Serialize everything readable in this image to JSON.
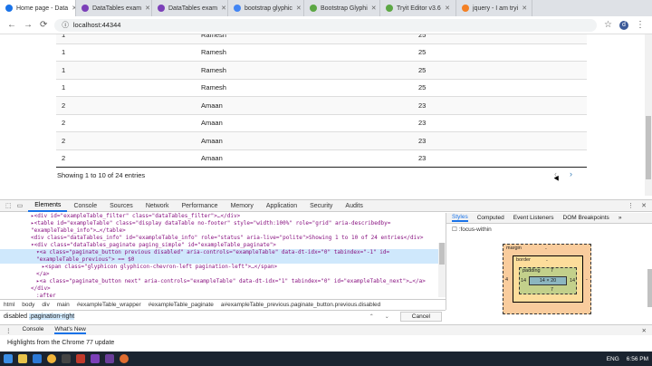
{
  "browser": {
    "tabs": [
      {
        "title": "Home page - Data",
        "color": "#1a73e8",
        "active": true
      },
      {
        "title": "DataTables exam",
        "color": "#7b3fb8",
        "active": false
      },
      {
        "title": "DataTables exam",
        "color": "#7b3fb8",
        "active": false
      },
      {
        "title": "bootstrap glyphic",
        "color": "#4285f4",
        "active": false
      },
      {
        "title": "Bootstrap Glyphi",
        "color": "#5ca744",
        "active": false
      },
      {
        "title": "Tryit Editor v3.6",
        "color": "#5ca744",
        "active": false
      },
      {
        "title": "jquery - I am tryi",
        "color": "#f48024",
        "active": false
      }
    ],
    "url": "localhost:44344",
    "avatar_letter": "d"
  },
  "table": {
    "rows": [
      [
        "1",
        "Ramesh",
        "25"
      ],
      [
        "1",
        "Ramesh",
        "25"
      ],
      [
        "1",
        "Ramesh",
        "25"
      ],
      [
        "1",
        "Ramesh",
        "25"
      ],
      [
        "2",
        "Amaan",
        "23"
      ],
      [
        "2",
        "Amaan",
        "23"
      ],
      [
        "2",
        "Amaan",
        "23"
      ],
      [
        "2",
        "Amaan",
        "23"
      ]
    ],
    "info": "Showing 1 to 10 of 24 entries",
    "prev_glyph": "‹",
    "next_glyph": "›"
  },
  "devtools": {
    "tabs": [
      "Elements",
      "Console",
      "Sources",
      "Network",
      "Performance",
      "Memory",
      "Application",
      "Security",
      "Audits"
    ],
    "active_tab": "Elements",
    "elements_lines": [
      "▸<div id=\"exampleTable_filter\" class=\"dataTables_filter\">…</div>",
      "▸<table id=\"exampleTable\" class=\"display dataTable no-footer\" style=\"width:100%\" role=\"grid\" aria-describedby=",
      "\"exampleTable_info\">…</table>",
      "<div class=\"dataTables_info\" id=\"exampleTable_info\" role=\"status\" aria-live=\"polite\">Showing 1 to 10 of 24 entries</div>",
      "▾<div class=\"dataTables_paginate paging_simple\" id=\"exampleTable_paginate\">",
      "▾<a class=\"paginate_button previous disabled\" aria-controls=\"exampleTable\" data-dt-idx=\"0\" tabindex=\"-1\" id=",
      "\"exampleTable_previous\"> == $0",
      "▸<span class=\"glyphicon glyphicon-chevron-left pagination-left\">…</span>",
      "</a>",
      "▸<a class=\"paginate_button next\" aria-controls=\"exampleTable\" data-dt-idx=\"1\" tabindex=\"0\" id=\"exampleTable_next\">…</a>",
      "</div>",
      ":after"
    ],
    "breadcrumbs": [
      "html",
      "body",
      "div",
      "main",
      "#exampleTable_wrapper",
      "#exampleTable_paginate",
      "a#exampleTable_previous.paginate_button.previous.disabled"
    ],
    "search_prefix": "disabled ",
    "search_highlight": ".pagination-right",
    "cancel_label": "Cancel",
    "styles_tabs": [
      "Styles",
      "Computed",
      "Event Listeners",
      "DOM Breakpoints"
    ],
    "styles_filter": ":focus-within",
    "box": {
      "margin_label": "margin",
      "margin_dash": "-",
      "border_label": "border",
      "border_dash": "-",
      "padding_label": "padding",
      "padding_top": "7",
      "padding_bottom": "7",
      "padding_left": "14",
      "padding_right": "14",
      "content": "14 × 20",
      "margin_left": "4",
      "margin_right": "-"
    },
    "drawer_tabs": [
      "Console",
      "What's New"
    ],
    "drawer_active": "What's New",
    "console_text": "Highlights from the Chrome 77 update"
  },
  "taskbar": {
    "lang": "ENG",
    "time": "6:56 PM"
  }
}
